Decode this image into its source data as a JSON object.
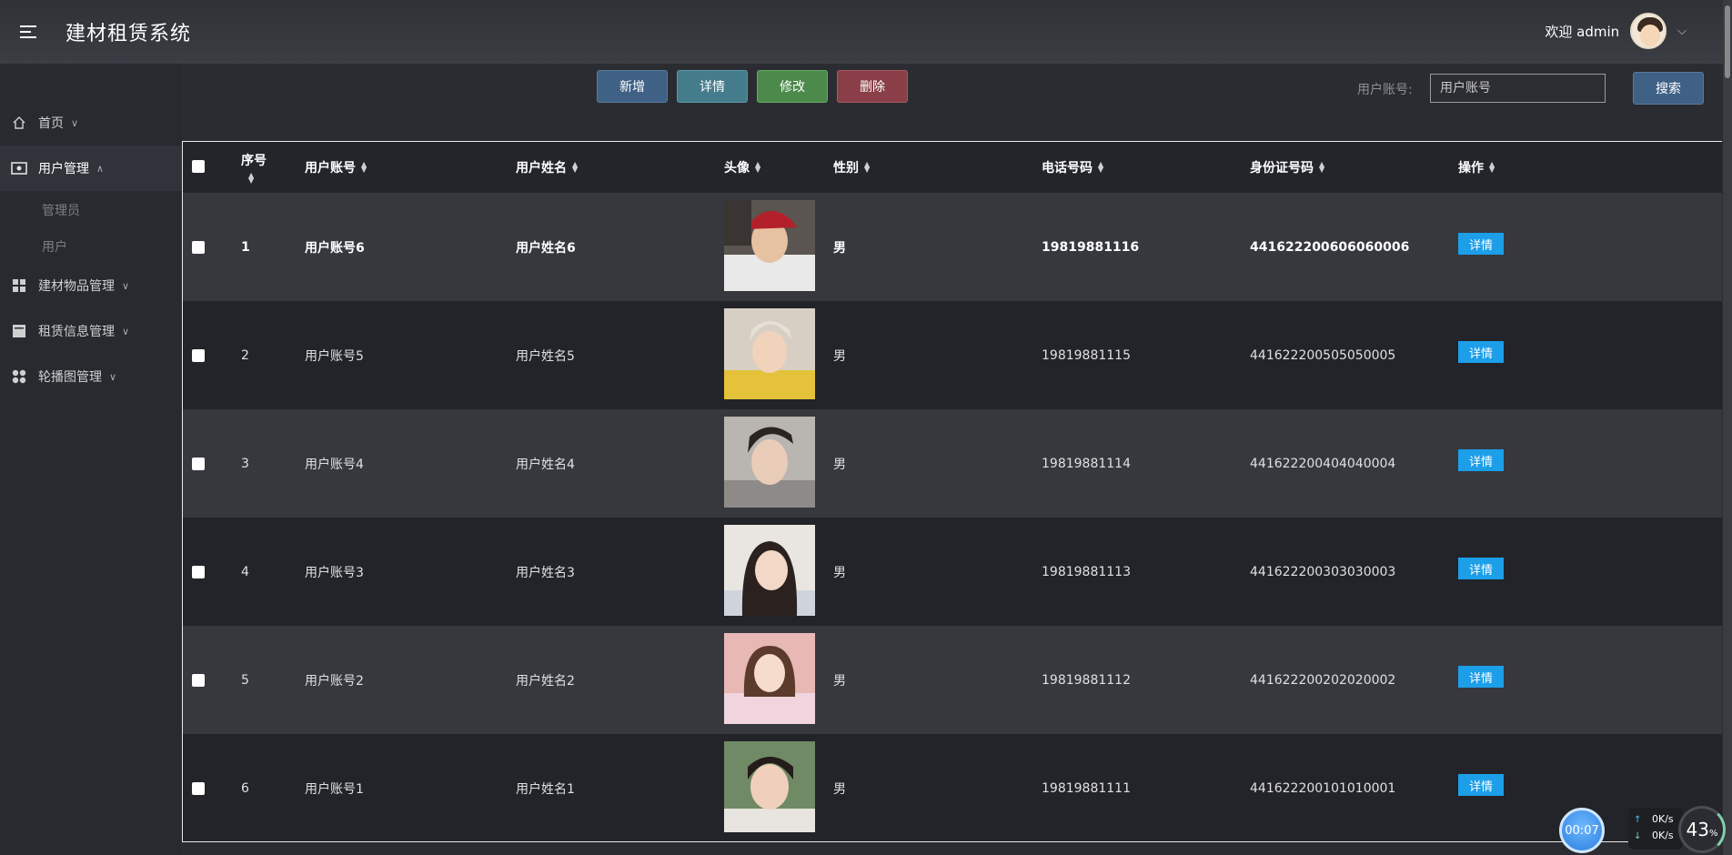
{
  "app": {
    "title": "建材租赁系统"
  },
  "header": {
    "welcome": "欢迎 admin"
  },
  "sidebar": {
    "items": [
      {
        "label": "首页",
        "icon": "home-icon"
      },
      {
        "label": "用户管理",
        "icon": "user-card-icon",
        "expanded": true
      },
      {
        "label": "建材物品管理",
        "icon": "grid-icon"
      },
      {
        "label": "租赁信息管理",
        "icon": "document-icon"
      },
      {
        "label": "轮播图管理",
        "icon": "circles-icon"
      }
    ],
    "sub_items": [
      "管理员",
      "用户"
    ]
  },
  "toolbar": {
    "add_label": "新增",
    "detail_label": "详情",
    "edit_label": "修改",
    "delete_label": "删除",
    "search_label": "用户账号:",
    "search_placeholder": "用户账号",
    "search_button": "搜索"
  },
  "table": {
    "headers": {
      "seq": "序号",
      "account": "用户账号",
      "name": "用户姓名",
      "avatar": "头像",
      "gender": "性别",
      "phone": "电话号码",
      "idcard": "身份证号码",
      "action": "操作"
    },
    "rows": [
      {
        "seq": "1",
        "account": "用户账号6",
        "name": "用户姓名6",
        "gender": "男",
        "phone": "19819881116",
        "idcard": "441622200606060006",
        "action": "详情"
      },
      {
        "seq": "2",
        "account": "用户账号5",
        "name": "用户姓名5",
        "gender": "男",
        "phone": "19819881115",
        "idcard": "441622200505050005",
        "action": "详情"
      },
      {
        "seq": "3",
        "account": "用户账号4",
        "name": "用户姓名4",
        "gender": "男",
        "phone": "19819881114",
        "idcard": "441622200404040004",
        "action": "详情"
      },
      {
        "seq": "4",
        "account": "用户账号3",
        "name": "用户姓名3",
        "gender": "男",
        "phone": "19819881113",
        "idcard": "441622200303030003",
        "action": "详情"
      },
      {
        "seq": "5",
        "account": "用户账号2",
        "name": "用户姓名2",
        "gender": "男",
        "phone": "19819881112",
        "idcard": "441622200202020002",
        "action": "详情"
      },
      {
        "seq": "6",
        "account": "用户账号1",
        "name": "用户姓名1",
        "gender": "男",
        "phone": "19819881111",
        "idcard": "441622200101010001",
        "action": "详情"
      }
    ]
  },
  "widget": {
    "timer": "00:07",
    "upload": "0K/s",
    "download": "0K/s",
    "percent": "43"
  },
  "colors": {
    "accent": "#1c9ee8",
    "add": "#3f6185",
    "detail": "#457c8c",
    "edit": "#4b8a4b",
    "delete": "#8a3f48"
  }
}
